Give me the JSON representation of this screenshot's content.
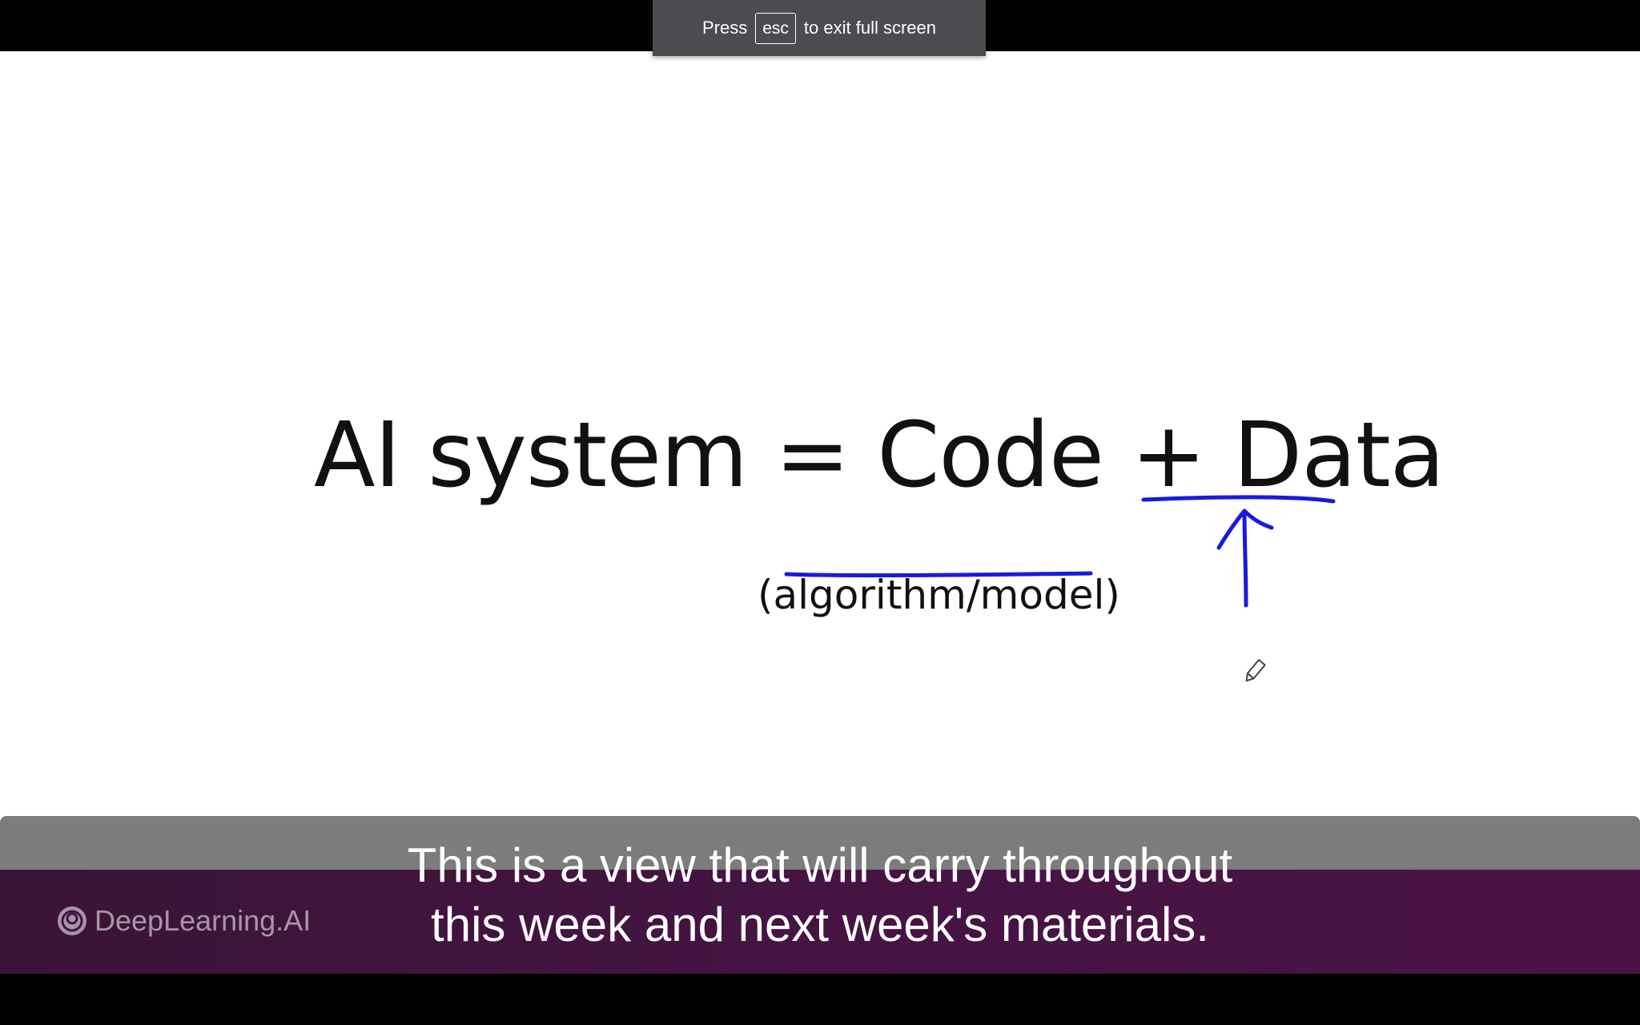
{
  "fullscreen_notice": {
    "press": "Press",
    "key": "esc",
    "suffix": "to exit full screen"
  },
  "slide": {
    "title": "AI system = Code + Data",
    "subtitle": "(algorithm/model)",
    "annotation_color": "#1a1adc"
  },
  "branding": {
    "name": "DeepLearning.AI"
  },
  "captions": {
    "line1": "This is a view that will carry throughout",
    "line2": "this week and next week's materials."
  },
  "cursor": {
    "icon": "pen-cursor-icon"
  }
}
